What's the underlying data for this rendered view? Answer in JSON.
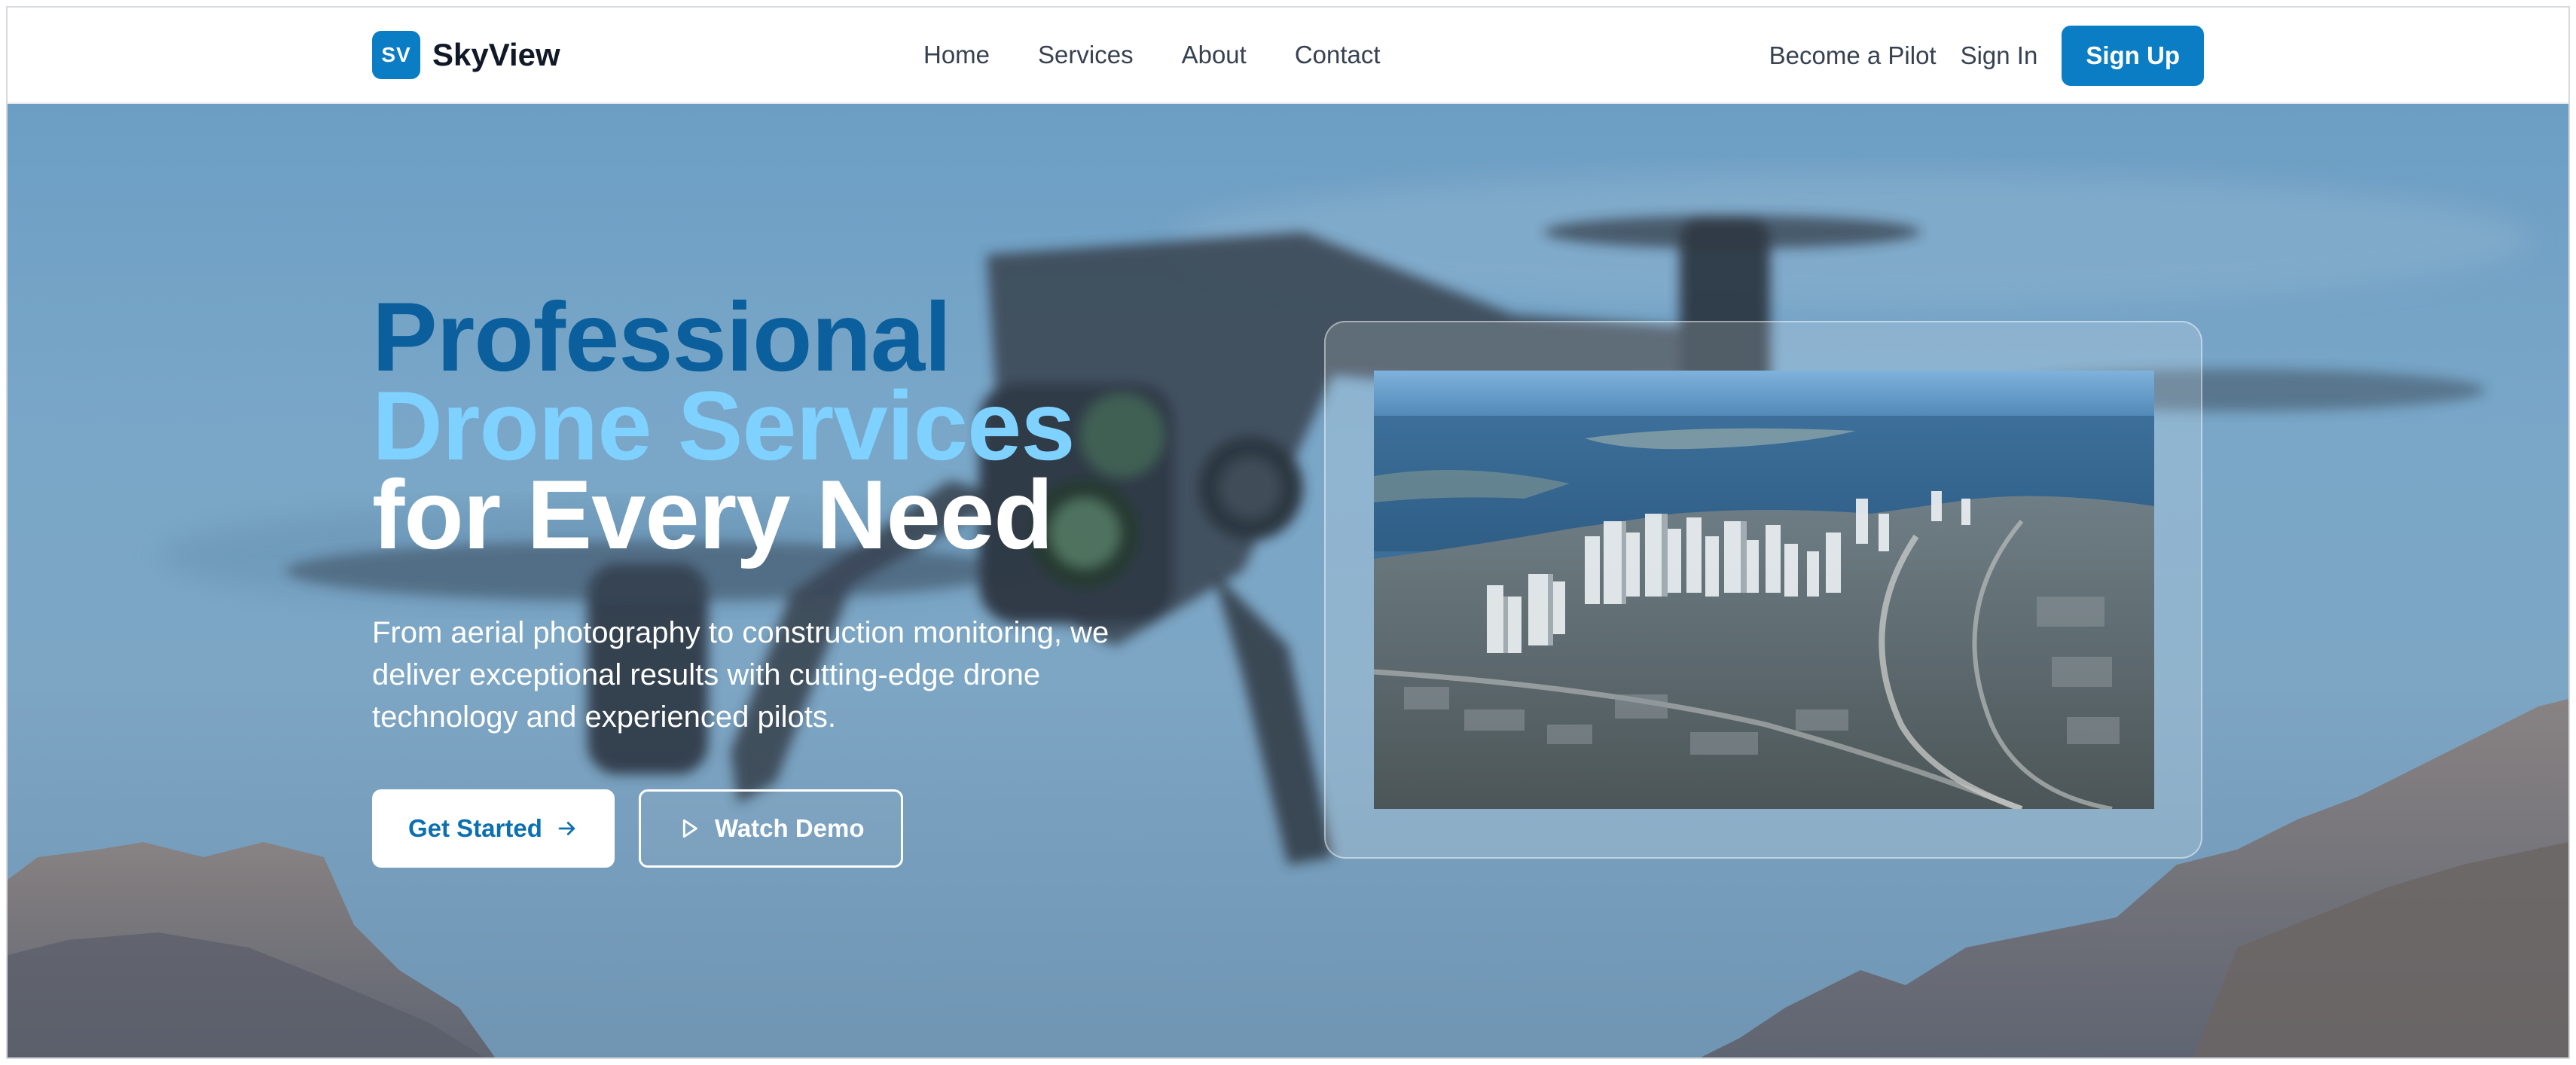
{
  "brand": {
    "badge": "SV",
    "name": "SkyView"
  },
  "nav": {
    "links": [
      "Home",
      "Services",
      "About",
      "Contact"
    ],
    "become_pilot": "Become a Pilot",
    "sign_in": "Sign In",
    "sign_up": "Sign Up"
  },
  "hero": {
    "headline_line1": "Professional",
    "headline_line2": "Drone Services",
    "headline_line3": "for Every Need",
    "subtext": "From aerial photography to construction monitoring, we deliver exceptional results with cutting-edge drone technology and experienced pilots.",
    "cta_primary": "Get Started",
    "cta_secondary": "Watch Demo"
  },
  "colors": {
    "accent": "#0b7dc4",
    "headline_dark": "#0b5f9c",
    "headline_light": "#7fd1ff"
  },
  "icons": {
    "cta_primary_icon": "arrow-right-icon",
    "cta_secondary_icon": "play-icon"
  }
}
